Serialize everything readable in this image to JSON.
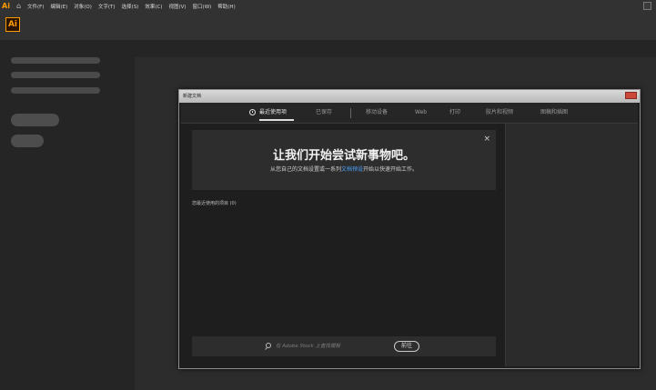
{
  "menubar": {
    "app_mark": "Ai",
    "items": [
      "文件(F)",
      "编辑(E)",
      "对象(O)",
      "文字(T)",
      "选择(S)",
      "效果(C)",
      "视图(V)",
      "窗口(W)",
      "帮助(H)"
    ]
  },
  "logo": {
    "text": "Ai",
    "accent": "#ff9a00"
  },
  "dialog": {
    "title": "新建文档",
    "tabs": [
      "最近使用项",
      "已保存",
      "移动设备",
      "Web",
      "打印",
      "胶片和视频",
      "图稿和插图"
    ],
    "welcome": {
      "title": "让我们开始尝试新事物吧。",
      "sub_before": "从您自己的文档设置或一系列",
      "sub_link": "文档预设",
      "sub_after": "开始以快速开始工作。",
      "close": "×"
    },
    "recent_label": "您最近使用的项目 (0)",
    "search": {
      "placeholder": "在 Adobe Stock 上查找模板",
      "go_label": "前往"
    }
  }
}
